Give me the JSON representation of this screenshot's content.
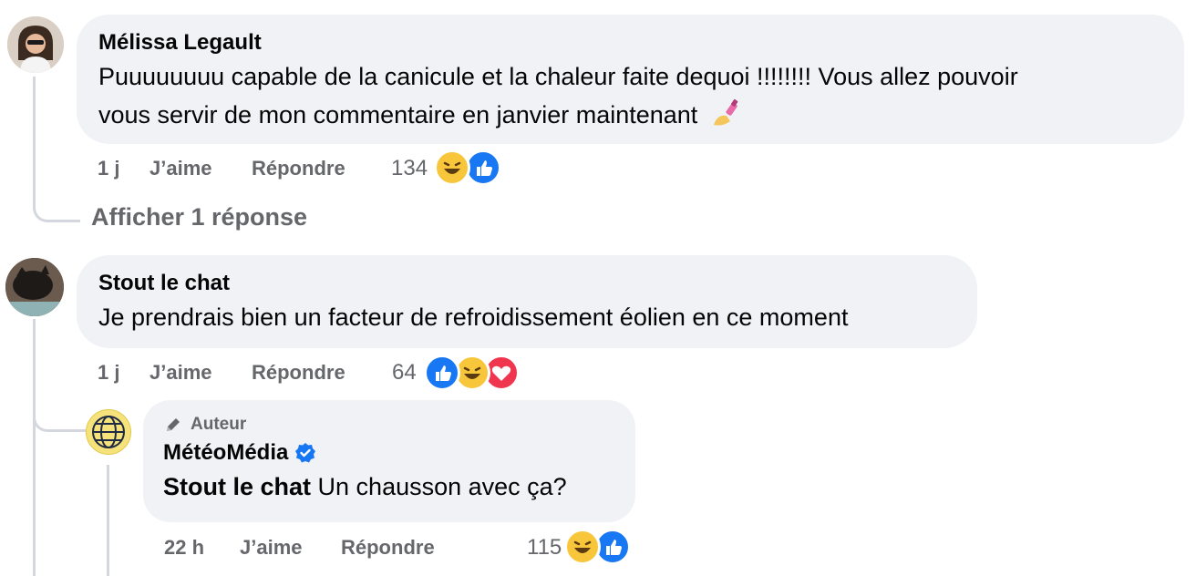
{
  "comments": [
    {
      "author": "Mélissa Legault",
      "text_line1": "Puuuuuuuu capable de la canicule et la chaleur faite dequoi !!!!!!!! Vous allez pouvoir",
      "text_line2": "vous servir de mon commentaire en janvier maintenant",
      "time": "1 j",
      "like_label": "J’aime",
      "reply_label": "Répondre",
      "reaction_count": "134",
      "reactions": [
        "haha",
        "like"
      ],
      "view_replies": "Afficher 1 réponse"
    },
    {
      "author": "Stout le chat",
      "text": "Je prendrais bien un facteur de refroidissement éolien en ce moment",
      "time": "1 j",
      "like_label": "J’aime",
      "reply_label": "Répondre",
      "reaction_count": "64",
      "reactions": [
        "like",
        "haha",
        "love"
      ]
    }
  ],
  "reply": {
    "badge": "Auteur",
    "author": "MétéoMédia",
    "verified": true,
    "mention": "Stout le chat",
    "text": "Un chausson avec ça?",
    "time": "22 h",
    "like_label": "J’aime",
    "reply_label": "Répondre",
    "reaction_count": "115",
    "reactions": [
      "haha",
      "like"
    ]
  },
  "colors": {
    "bubble": "#f0f2f5",
    "meta": "#65676b",
    "like": "#1877f2",
    "haha": "#f7c63b",
    "love": "#f0364f",
    "verified": "#1877f2"
  }
}
